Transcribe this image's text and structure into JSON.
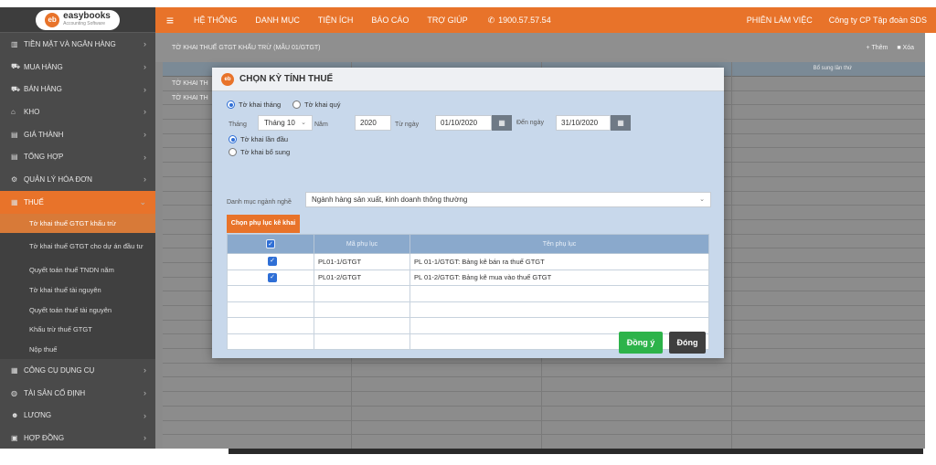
{
  "app": {
    "brand": "easybooks",
    "brand_tagline": "Accounting Software",
    "brand_badge": "eb"
  },
  "topbar": {
    "nav": [
      "HỆ THỐNG",
      "DANH MỤC",
      "TIỆN ÍCH",
      "BÁO CÁO",
      "TRỢ GIÚP"
    ],
    "phone": "1900.57.57.54",
    "session": "PHIÊN LÀM VIỆC",
    "company": "Công ty CP Tập đoàn SDS"
  },
  "sidebar": {
    "items_top": [
      {
        "label": "TIỀN MẶT VÀ NGÂN HÀNG",
        "icon": "bank-icon"
      },
      {
        "label": "MUA HÀNG",
        "icon": "cart-icon"
      },
      {
        "label": "BÁN HÀNG",
        "icon": "cart-icon"
      },
      {
        "label": "KHO",
        "icon": "warehouse-icon"
      },
      {
        "label": "GIÁ THÀNH",
        "icon": "price-icon"
      },
      {
        "label": "TỔNG HỢP",
        "icon": "summary-icon"
      },
      {
        "label": "QUẢN LÝ HÓA ĐƠN",
        "icon": "gear-icon"
      },
      {
        "label": "THUẾ",
        "icon": "tax-icon"
      }
    ],
    "sub_items": [
      "Tờ khai thuế GTGT khấu trừ",
      "Tờ khai thuế GTGT cho dự án đầu tư",
      "Quyết toán thuế TNDN năm",
      "Tờ khai thuế tài nguyên",
      "Quyết toán thuế tài nguyên",
      "Khấu trừ thuế GTGT",
      "Nộp thuế"
    ],
    "items_bottom": [
      {
        "label": "CÔNG CỤ DỤNG CỤ",
        "icon": "tools-icon"
      },
      {
        "label": "TÀI SẢN CỐ ĐỊNH",
        "icon": "asset-icon"
      },
      {
        "label": "LƯƠNG",
        "icon": "users-icon"
      },
      {
        "label": "HỢP ĐỒNG",
        "icon": "contract-icon"
      }
    ]
  },
  "content": {
    "title": "TỜ KHAI THUẾ GTGT KHẤU TRỪ (MẪU 01/GTGT)",
    "add": "+ Thêm",
    "delete": "Xóa",
    "grid_extra_header": "Bổ sung lần thứ",
    "grid_rows": [
      "TỜ KHAI TH",
      "TỜ KHAI TH"
    ]
  },
  "dialog": {
    "title": "CHỌN KỲ TÍNH THUẾ",
    "radio_month": "Tờ khai tháng",
    "radio_quarter": "Tờ khai quý",
    "month_label": "Tháng",
    "month_value": "Tháng 10",
    "year_label": "Năm",
    "year_value": "2020",
    "from_label": "Từ ngày",
    "from_value": "01/10/2020",
    "to_label": "Đến ngày",
    "to_value": "31/10/2020",
    "radio_first": "Tờ khai lần đầu",
    "radio_supplement": "Tờ khai bổ sung",
    "industry_label": "Danh mục ngành nghề",
    "industry_value": "Ngành hàng sản xuất, kinh doanh thông thường",
    "tab_label": "Chọn phụ lục kê khai",
    "table": {
      "col_code": "Mã phụ lục",
      "col_name": "Tên phụ lục",
      "rows": [
        {
          "code": "PL01-1/GTGT",
          "name": "PL 01-1/GTGT: Bảng kê bán ra thuế GTGT"
        },
        {
          "code": "PL01-2/GTGT",
          "name": "PL 01-2/GTGT: Bảng kê mua vào thuế GTGT"
        }
      ]
    },
    "ok": "Đồng ý",
    "close": "Đóng"
  }
}
